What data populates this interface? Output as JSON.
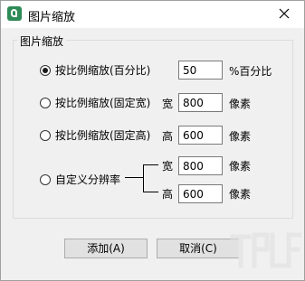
{
  "window": {
    "title": "图片缩放",
    "icon": "app-logo-icon",
    "close_icon": "close-icon"
  },
  "group": {
    "label": "图片缩放"
  },
  "options": {
    "percent": {
      "label": "按比例缩放(百分比)",
      "value": "50",
      "unit": "%百分比",
      "checked": true
    },
    "fixed_width": {
      "label": "按比例缩放(固定宽)",
      "field_label": "宽",
      "value": "800",
      "unit": "像素",
      "checked": false
    },
    "fixed_height": {
      "label": "按比例缩放(固定高)",
      "field_label": "高",
      "value": "600",
      "unit": "像素",
      "checked": false
    },
    "custom": {
      "label": "自定义分辨率",
      "width_label": "宽",
      "width_value": "800",
      "width_unit": "像素",
      "height_label": "高",
      "height_value": "600",
      "height_unit": "像素",
      "checked": false
    }
  },
  "buttons": {
    "add": "添加(A)",
    "cancel": "取消(C)"
  }
}
